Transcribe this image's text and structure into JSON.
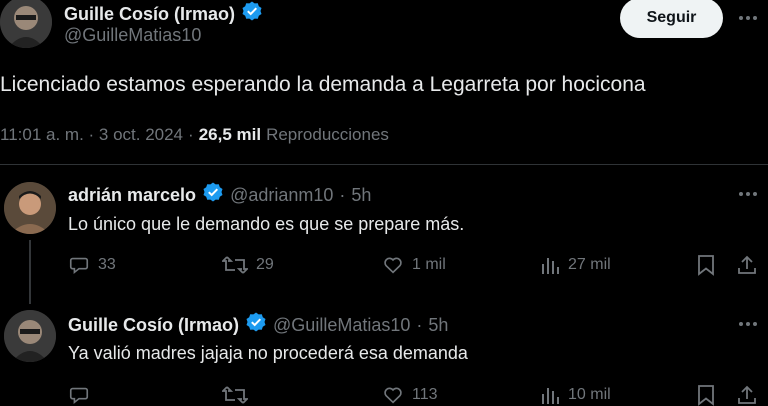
{
  "main_tweet": {
    "author_name": "Guille Cosío (Irmao)",
    "author_handle": "@GuilleMatias10",
    "follow_label": "Seguir",
    "text": "Licenciado estamos esperando la demanda a Legarreta por hocicona",
    "time": "11:01 a. m. · 3 oct. 2024",
    "separator": "·",
    "views_count": "26,5 mil",
    "views_label": "Reproducciones"
  },
  "replies": [
    {
      "author_name": "adrián marcelo",
      "author_handle": "@adrianm10",
      "meta_sep": "·",
      "time": "5h",
      "text": "Lo único que le demando es que se prepare más.",
      "replies": "33",
      "reposts": "29",
      "likes": "1 mil",
      "views": "27 mil"
    },
    {
      "author_name": "Guille Cosío (Irmao)",
      "author_handle": "@GuilleMatias10",
      "meta_sep": "·",
      "time": "5h",
      "text": "Ya valió madres jajaja no procederá esa demanda",
      "replies": "",
      "reposts": "",
      "likes": "113",
      "views": "10 mil"
    }
  ],
  "colors": {
    "background": "#000000",
    "text": "#e7e9ea",
    "muted": "#71767b",
    "verified": "#1d9bf0",
    "divider": "#2f3336"
  }
}
